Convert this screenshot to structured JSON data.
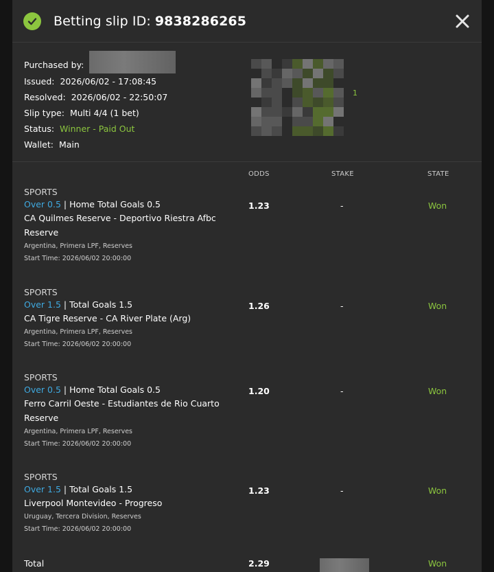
{
  "header": {
    "title_prefix": "Betting slip ID:",
    "slip_id": "9838286265",
    "close_icon": "close-icon",
    "status_icon": "check-circle-icon",
    "accent_color": "#8cc63f"
  },
  "info": {
    "purchased_by_label": "Purchased by:",
    "issued_label": "Issued:",
    "issued_value": "2026/06/02 - 17:08:45",
    "resolved_label": "Resolved:",
    "resolved_value": "2026/06/02 - 22:50:07",
    "slip_type_label": "Slip type:",
    "slip_type_value": "Multi 4/4 (1 bet)",
    "status_label": "Status:",
    "status_value": "Winner - Paid Out",
    "wallet_label": "Wallet:",
    "wallet_value": "Main",
    "mosaic_digit": "1"
  },
  "columns": {
    "odds": "ODDS",
    "stake": "STAKE",
    "state": "STATE"
  },
  "bets": [
    {
      "category": "SPORTS",
      "selection": "Over 0.5",
      "market": " | Home Total Goals 0.5",
      "match": "CA Quilmes Reserve - Deportivo Riestra Afbc Reserve",
      "league": "Argentina, Primera LPF, Reserves",
      "start": "Start Time: 2026/06/02 20:00:00",
      "odds": "1.23",
      "stake": "-",
      "state": "Won"
    },
    {
      "category": "SPORTS",
      "selection": "Over 1.5",
      "market": " | Total Goals 1.5",
      "match": "CA Tigre Reserve - CA River Plate (Arg)",
      "league": "Argentina, Primera LPF, Reserves",
      "start": "Start Time: 2026/06/02 20:00:00",
      "odds": "1.26",
      "stake": "-",
      "state": "Won"
    },
    {
      "category": "SPORTS",
      "selection": "Over 0.5",
      "market": " | Home Total Goals 0.5",
      "match": "Ferro Carril Oeste - Estudiantes de Rio Cuarto Reserve",
      "league": "Argentina, Primera LPF, Reserves",
      "start": "Start Time: 2026/06/02 20:00:00",
      "odds": "1.20",
      "stake": "-",
      "state": "Won"
    },
    {
      "category": "SPORTS",
      "selection": "Over 1.5",
      "market": " | Total Goals 1.5",
      "match": "Liverpool Montevideo - Progreso",
      "league": "Uruguay, Tercera Division, Reserves",
      "start": "Start Time: 2026/06/02 20:00:00",
      "odds": "1.23",
      "stake": "-",
      "state": "Won"
    }
  ],
  "total": {
    "label": "Total",
    "odds": "2.29",
    "state": "Won"
  }
}
